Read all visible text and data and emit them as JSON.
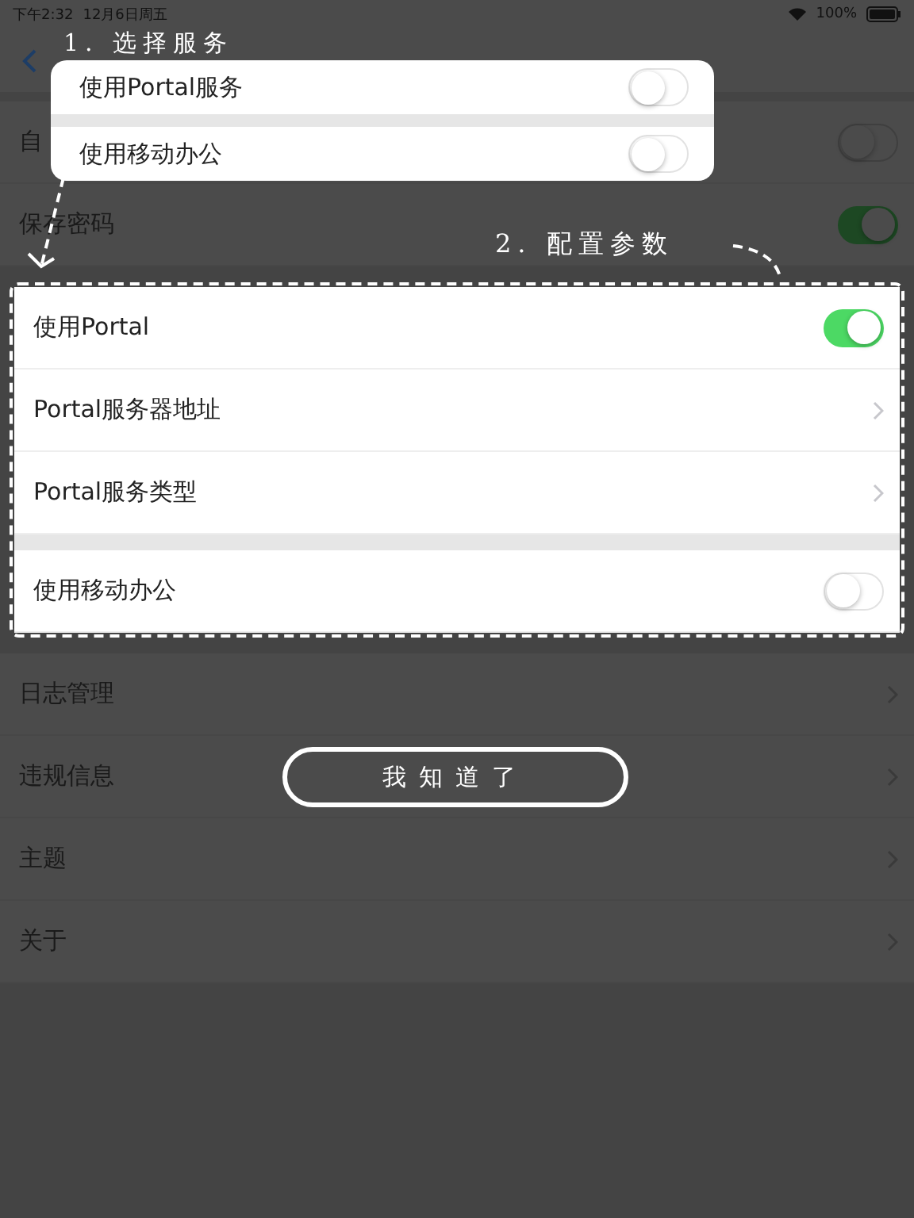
{
  "status_bar": {
    "time": "下午2:32",
    "date": "12月6日周五",
    "battery": "100%"
  },
  "settings": {
    "top_rows": [
      {
        "label": "自",
        "kind": "toggle",
        "on": false
      },
      {
        "label": "保存密码",
        "kind": "toggle",
        "on": true
      }
    ],
    "highlighted_groups": [
      [
        {
          "label": "使用Portal",
          "kind": "toggle",
          "on": true
        },
        {
          "label": "Portal服务器地址",
          "kind": "link"
        },
        {
          "label": "Portal服务类型",
          "kind": "link"
        }
      ],
      [
        {
          "label": "使用移动办公",
          "kind": "toggle",
          "on": false
        }
      ]
    ],
    "bottom_rows": [
      {
        "label": "日志管理",
        "kind": "link"
      },
      {
        "label": "违规信息",
        "kind": "link"
      },
      {
        "label": "主题",
        "kind": "link"
      },
      {
        "label": "关于",
        "kind": "link"
      }
    ]
  },
  "guide": {
    "step1_title": "1. 选择服务",
    "step1_options": [
      {
        "label": "使用Portal服务",
        "on": false
      },
      {
        "label": "使用移动办公",
        "on": false
      }
    ],
    "step2_title": "2. 配置参数",
    "dismiss_button": "我知道了"
  }
}
